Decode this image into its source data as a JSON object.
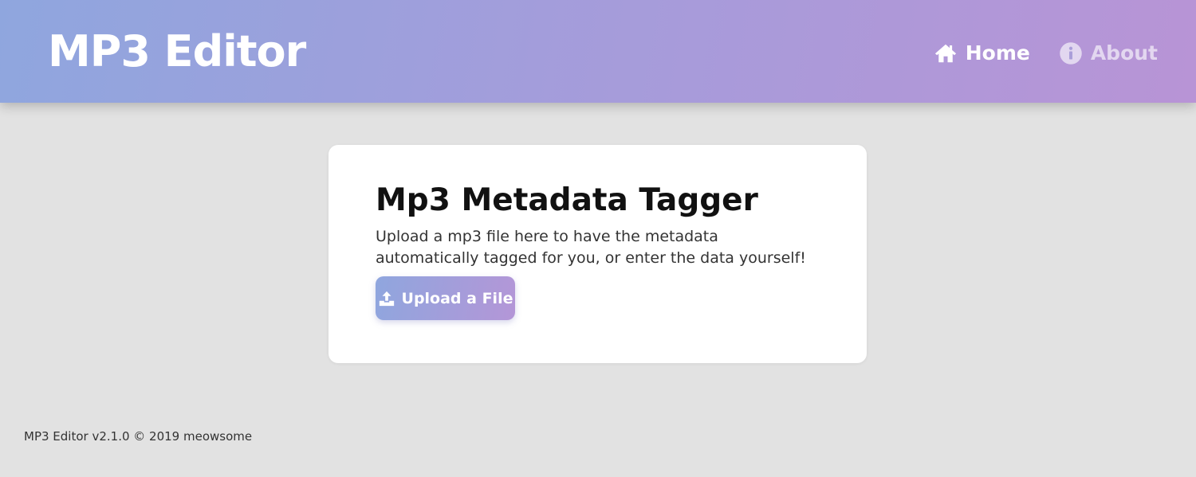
{
  "header": {
    "title": "MP3 Editor",
    "nav": {
      "home": {
        "label": "Home",
        "icon": "home-icon"
      },
      "about": {
        "label": "About",
        "icon": "info-icon"
      }
    }
  },
  "card": {
    "title": "Mp3 Metadata Tagger",
    "description": "Upload a mp3 file here to have the metadata automatically tagged for you, or enter the data yourself!",
    "upload_button": {
      "label": "Upload a File",
      "icon": "upload-icon"
    }
  },
  "footer": {
    "text": "MP3 Editor v2.1.0 © 2019 meowsome"
  },
  "colors": {
    "gradient_start": "#8fa6de",
    "gradient_end": "#b894d6",
    "background": "#e2e2e2",
    "card_background": "#ffffff"
  }
}
